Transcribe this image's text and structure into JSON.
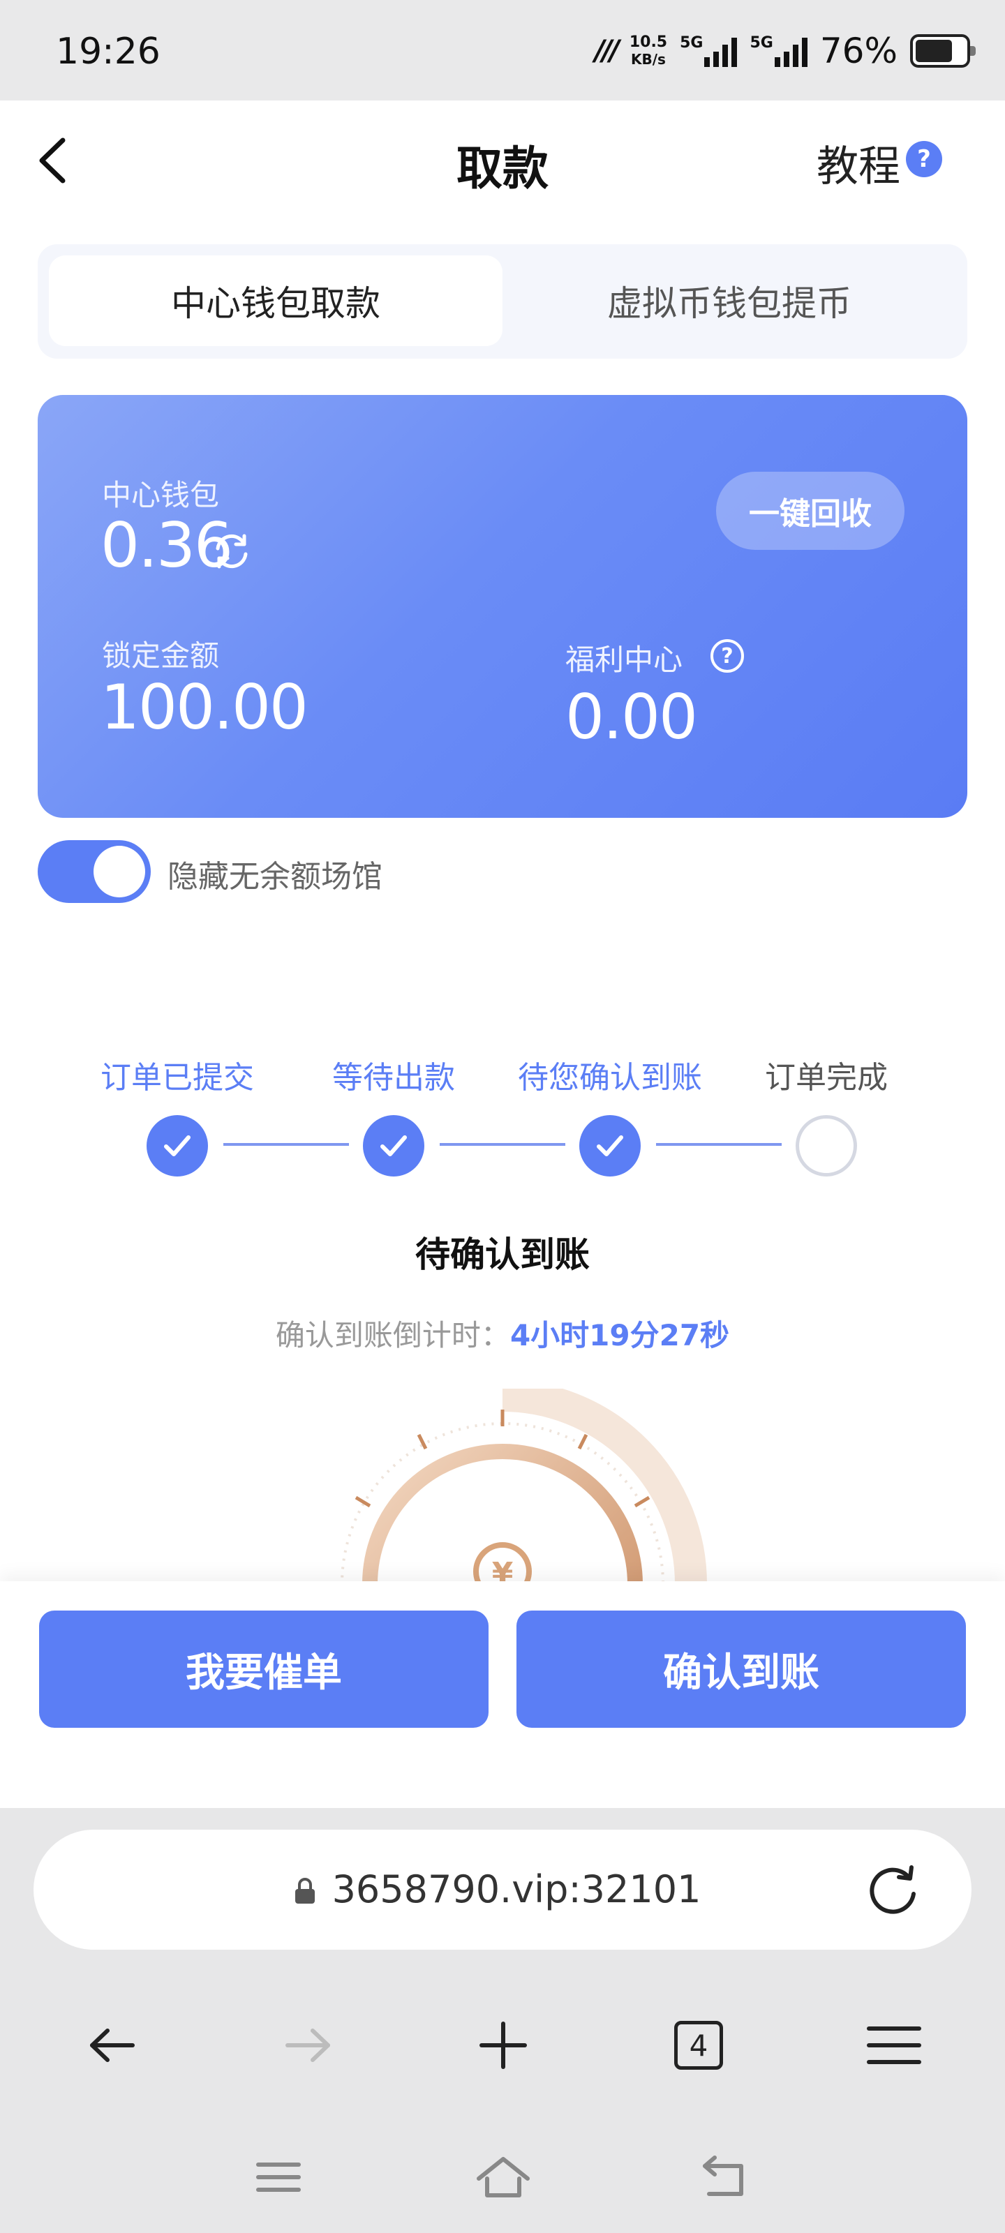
{
  "status_bar": {
    "time": "19:26",
    "net_speed_value": "10.5",
    "net_speed_unit": "KB/s",
    "signal1_label": "5G",
    "signal2_label": "5G",
    "battery": "76%"
  },
  "header": {
    "title": "取款",
    "tutorial_label": "教程",
    "help_glyph": "?"
  },
  "tabs": [
    {
      "label": "中心钱包取款",
      "active": true
    },
    {
      "label": "虚拟币钱包提币",
      "active": false
    }
  ],
  "wallet": {
    "center_wallet_label": "中心钱包",
    "center_wallet_value": "0.36",
    "recover_button": "一键回收",
    "locked_label": "锁定金额",
    "locked_value": "100.00",
    "welfare_label": "福利中心",
    "welfare_value": "0.00"
  },
  "toggle": {
    "label": "隐藏无余额场馆",
    "on": true
  },
  "steps": [
    {
      "label": "订单已提交",
      "done": true
    },
    {
      "label": "等待出款",
      "done": true
    },
    {
      "label": "待您确认到账",
      "done": true
    },
    {
      "label": "订单完成",
      "done": false
    }
  ],
  "status": {
    "title": "待确认到账",
    "countdown_prefix": "确认到账倒计时：",
    "countdown_value": "4小时19分27秒"
  },
  "actions": {
    "urge_button": "我要催单",
    "confirm_button": "确认到账"
  },
  "browser": {
    "url": "3658790.vip:32101",
    "tab_count": "4"
  },
  "colors": {
    "accent": "#5b7ef5",
    "card_gradient_start": "#8aa6f7",
    "card_gradient_end": "#5a7cf4",
    "dial_gold": "#d9a47a"
  }
}
